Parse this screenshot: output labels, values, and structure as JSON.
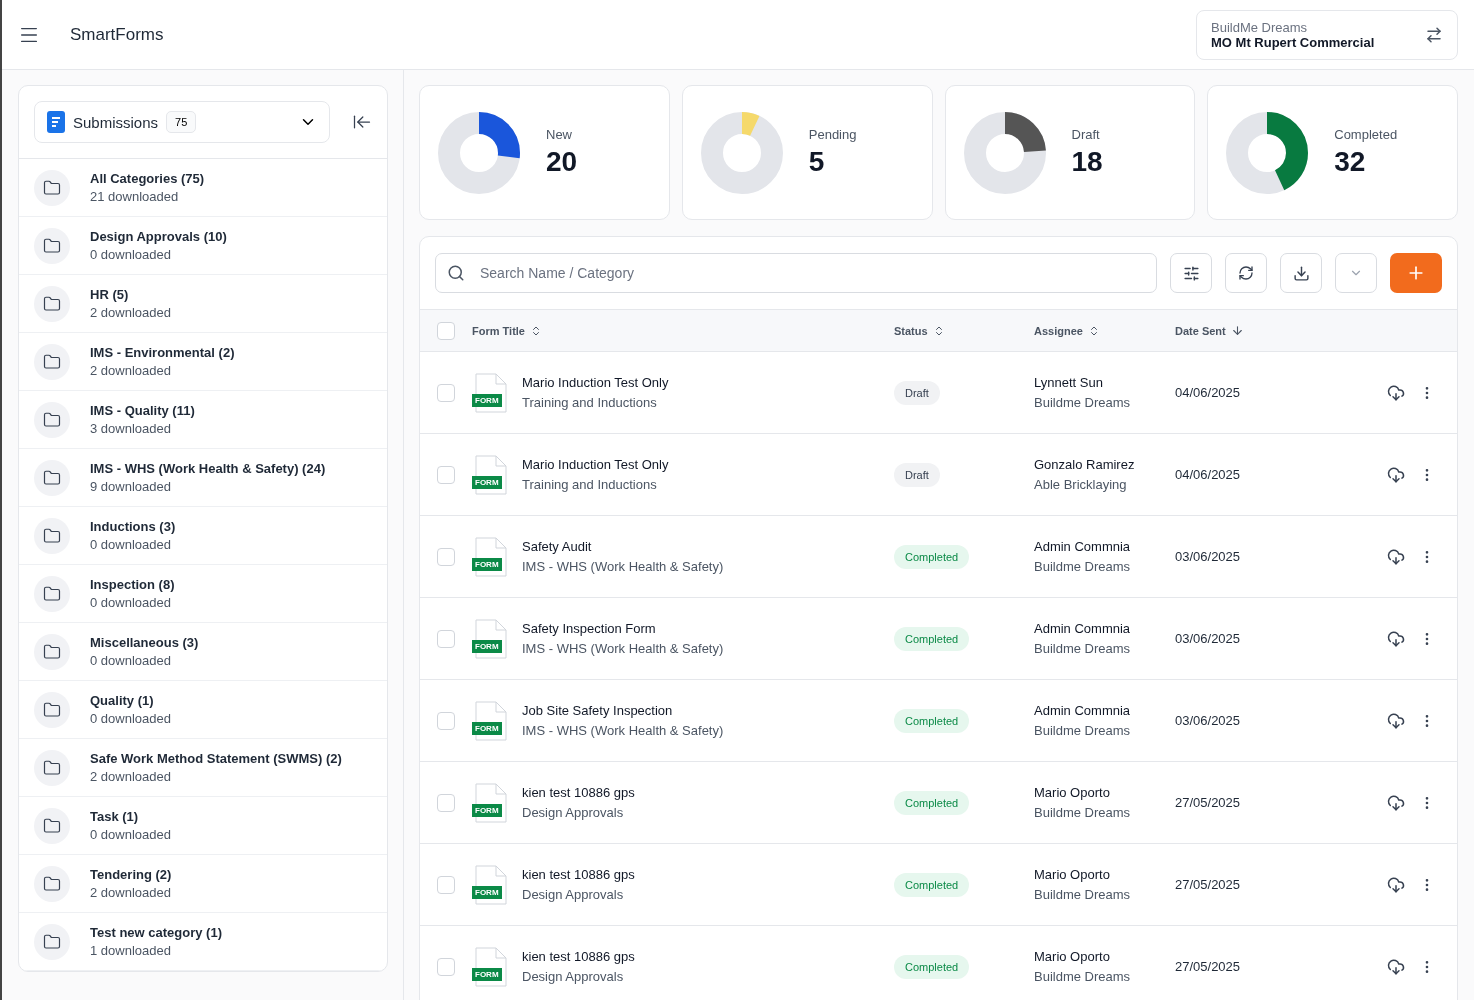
{
  "header": {
    "app_title": "SmartForms",
    "org": {
      "company": "BuildMe Dreams",
      "project": "MO Mt Rupert Commercial"
    }
  },
  "sidebar": {
    "selector": {
      "label": "Submissions",
      "count": "75"
    },
    "categories": [
      {
        "name": "All Categories (75)",
        "sub": "21 downloaded"
      },
      {
        "name": "Design Approvals (10)",
        "sub": "0 downloaded"
      },
      {
        "name": "HR (5)",
        "sub": "2 downloaded"
      },
      {
        "name": "IMS - Environmental (2)",
        "sub": "2 downloaded"
      },
      {
        "name": "IMS - Quality (11)",
        "sub": "3 downloaded"
      },
      {
        "name": "IMS - WHS (Work Health & Safety) (24)",
        "sub": "9 downloaded"
      },
      {
        "name": "Inductions (3)",
        "sub": "0 downloaded"
      },
      {
        "name": "Inspection (8)",
        "sub": "0 downloaded"
      },
      {
        "name": "Miscellaneous (3)",
        "sub": "0 downloaded"
      },
      {
        "name": "Quality (1)",
        "sub": "0 downloaded"
      },
      {
        "name": "Safe Work Method Statement (SWMS) (2)",
        "sub": "2 downloaded"
      },
      {
        "name": "Task (1)",
        "sub": "0 downloaded"
      },
      {
        "name": "Tendering (2)",
        "sub": "2 downloaded"
      },
      {
        "name": "Test new category (1)",
        "sub": "1 downloaded"
      }
    ]
  },
  "stats": [
    {
      "label": "New",
      "value": "20",
      "level": 0.27,
      "color": "#1a56db"
    },
    {
      "label": "Pending",
      "value": "5",
      "level": 0.07,
      "color": "#f5d96b"
    },
    {
      "label": "Draft",
      "value": "18",
      "level": 0.24,
      "color": "#555555"
    },
    {
      "label": "Completed",
      "value": "32",
      "level": 0.43,
      "color": "#087a40"
    }
  ],
  "search": {
    "placeholder": "Search Name / Category"
  },
  "table": {
    "select_all": {
      "checked": false
    },
    "columns": [
      {
        "label": "Form Title",
        "sorted": false
      },
      {
        "label": "Status",
        "sorted": false
      },
      {
        "label": "Assignee",
        "sorted": false
      },
      {
        "label": "Date Sent",
        "sorted": true
      }
    ],
    "rows": [
      {
        "checked": false,
        "badge": "FORM",
        "title": "Mario Induction Test Only",
        "category": "Training and Inductions",
        "status": {
          "label": "Draft",
          "kind": "draft"
        },
        "assignee": "Lynnett Sun",
        "company": "Buildme Dreams",
        "date": "04/06/2025"
      },
      {
        "checked": false,
        "badge": "FORM",
        "title": "Mario Induction Test Only",
        "category": "Training and Inductions",
        "status": {
          "label": "Draft",
          "kind": "draft"
        },
        "assignee": "Gonzalo Ramirez",
        "company": "Able Bricklaying",
        "date": "04/06/2025"
      },
      {
        "checked": false,
        "badge": "FORM",
        "title": "Safety Audit",
        "category": "IMS - WHS (Work Health & Safety)",
        "status": {
          "label": "Completed",
          "kind": "completed"
        },
        "assignee": "Admin Commnia",
        "company": "Buildme Dreams",
        "date": "03/06/2025"
      },
      {
        "checked": false,
        "badge": "FORM",
        "title": "Safety Inspection Form",
        "category": "IMS - WHS (Work Health & Safety)",
        "status": {
          "label": "Completed",
          "kind": "completed"
        },
        "assignee": "Admin Commnia",
        "company": "Buildme Dreams",
        "date": "03/06/2025"
      },
      {
        "checked": false,
        "badge": "FORM",
        "title": "Job Site Safety Inspection",
        "category": "IMS - WHS (Work Health & Safety)",
        "status": {
          "label": "Completed",
          "kind": "completed"
        },
        "assignee": "Admin Commnia",
        "company": "Buildme Dreams",
        "date": "03/06/2025"
      },
      {
        "checked": false,
        "badge": "FORM",
        "title": "kien test 10886 gps",
        "category": "Design Approvals",
        "status": {
          "label": "Completed",
          "kind": "completed"
        },
        "assignee": "Mario Oporto",
        "company": "Buildme Dreams",
        "date": "27/05/2025"
      },
      {
        "checked": false,
        "badge": "FORM",
        "title": "kien test 10886 gps",
        "category": "Design Approvals",
        "status": {
          "label": "Completed",
          "kind": "completed"
        },
        "assignee": "Mario Oporto",
        "company": "Buildme Dreams",
        "date": "27/05/2025"
      },
      {
        "checked": false,
        "badge": "FORM",
        "title": "kien test 10886 gps",
        "category": "Design Approvals",
        "status": {
          "label": "Completed",
          "kind": "completed"
        },
        "assignee": "Mario Oporto",
        "company": "Buildme Dreams",
        "date": "27/05/2025"
      }
    ]
  }
}
